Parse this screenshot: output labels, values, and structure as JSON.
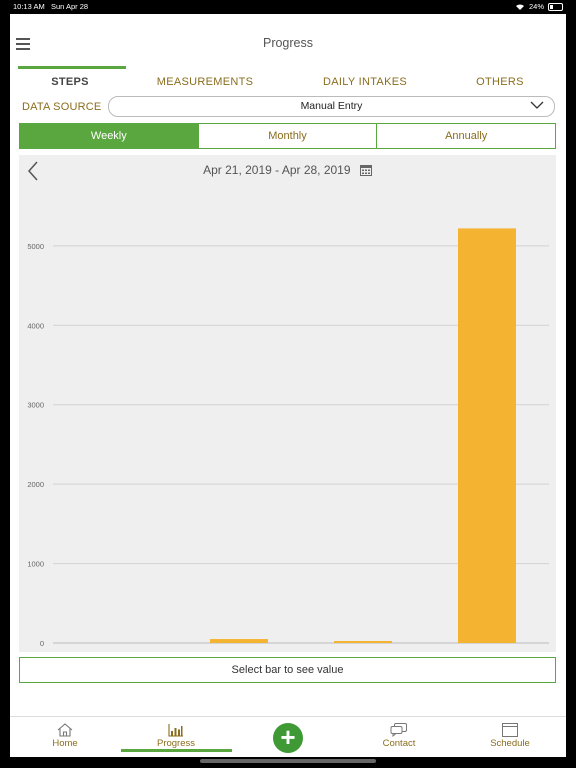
{
  "status": {
    "time": "10:13 AM",
    "date": "Sun Apr 28",
    "battery": "24%"
  },
  "header": {
    "title": "Progress",
    "menu_icon": "hamburger-icon"
  },
  "tabs": [
    {
      "label": "STEPS",
      "active": true
    },
    {
      "label": "MEASUREMENTS",
      "active": false
    },
    {
      "label": "DAILY INTAKES",
      "active": false
    },
    {
      "label": "OTHERS",
      "active": false
    }
  ],
  "data_source": {
    "label": "DATA SOURCE",
    "value": "Manual Entry"
  },
  "period": {
    "options": [
      "Weekly",
      "Monthly",
      "Annually"
    ],
    "selected": "Weekly"
  },
  "date_range": "Apr 21, 2019 - Apr 28, 2019",
  "hint": "Select bar to see value",
  "nav": {
    "items": [
      "Home",
      "Progress",
      "Contact",
      "Schedule"
    ],
    "active": "Progress"
  },
  "colors": {
    "accent": "#5aa63f",
    "bar": "#f4b431",
    "text_gold": "#8a6d1d"
  },
  "chart_data": {
    "type": "bar",
    "categories": [
      "",
      "",
      "",
      ""
    ],
    "values": [
      0,
      50,
      25,
      5220
    ],
    "ylim": [
      0,
      5200
    ],
    "yticks": [
      0,
      1000,
      2000,
      3000,
      4000,
      5000
    ],
    "grid": true,
    "title": "",
    "xlabel": "",
    "ylabel": ""
  }
}
